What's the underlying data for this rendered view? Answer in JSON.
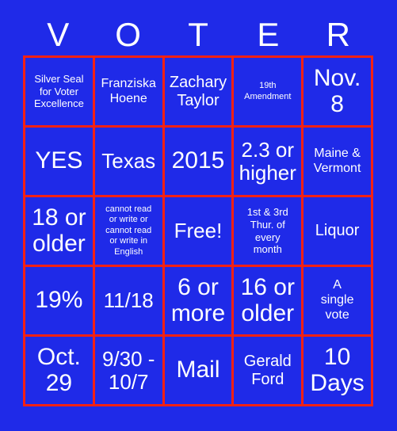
{
  "card": {
    "title_letters": [
      "V",
      "O",
      "T",
      "E",
      "R"
    ],
    "colors": {
      "background": "#1f2ae8",
      "grid_line": "#f42113",
      "text": "#ffffff"
    }
  },
  "grid": {
    "rows": [
      [
        {
          "text": "Silver Seal\nfor Voter\nExcellence",
          "size": "sm"
        },
        {
          "text": "Franziska\nHoene",
          "size": "md"
        },
        {
          "text": "Zachary\nTaylor",
          "size": "lg"
        },
        {
          "text": "19th\nAmendment",
          "size": "xs"
        },
        {
          "text": "Nov.\n8",
          "size": "xxl"
        }
      ],
      [
        {
          "text": "YES",
          "size": "xxl"
        },
        {
          "text": "Texas",
          "size": "xl"
        },
        {
          "text": "2015",
          "size": "xxl"
        },
        {
          "text": "2.3 or\nhigher",
          "size": "xl"
        },
        {
          "text": "Maine &\nVermont",
          "size": "md"
        }
      ],
      [
        {
          "text": "18 or\nolder",
          "size": "xxl"
        },
        {
          "text": "cannot read\nor write or\ncannot read\nor write in\nEnglish",
          "size": "xs"
        },
        {
          "text": "Free!",
          "size": "xl"
        },
        {
          "text": "1st & 3rd\nThur. of\nevery\nmonth",
          "size": "sm"
        },
        {
          "text": "Liquor",
          "size": "lg"
        }
      ],
      [
        {
          "text": "19%",
          "size": "xxl"
        },
        {
          "text": "11/18",
          "size": "xl"
        },
        {
          "text": "6 or\nmore",
          "size": "xxl"
        },
        {
          "text": "16 or\nolder",
          "size": "xxl"
        },
        {
          "text": "A\nsingle\nvote",
          "size": "md"
        }
      ],
      [
        {
          "text": "Oct.\n29",
          "size": "xxl"
        },
        {
          "text": "9/30 -\n10/7",
          "size": "xl"
        },
        {
          "text": "Mail",
          "size": "xxl"
        },
        {
          "text": "Gerald\nFord",
          "size": "lg"
        },
        {
          "text": "10\nDays",
          "size": "xxl"
        }
      ]
    ]
  }
}
